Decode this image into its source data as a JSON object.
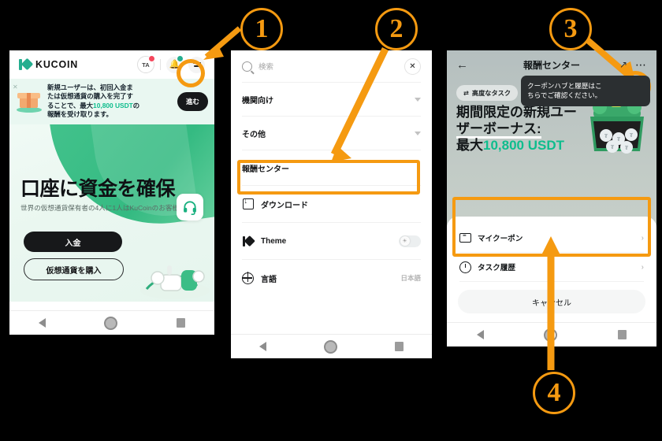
{
  "accent": "#f59a11",
  "brand_green": "#24ae8f",
  "steps": [
    {
      "num": "1"
    },
    {
      "num": "2"
    },
    {
      "num": "3"
    },
    {
      "num": "4"
    }
  ],
  "phone1": {
    "header": {
      "logo_text": "KUCOIN",
      "avatar_initials": "TA",
      "bell_icon": "bell-icon",
      "menu_icon": "hamburger-menu-icon"
    },
    "promo": {
      "line1": "新規ユーザーは、初回入金ま",
      "line2": "たは仮想通貨の購入を完了す",
      "line3_pre": "ることで、最大",
      "line3_hl": "10,800 USDT",
      "line3_post": "の",
      "line4": "報酬を受け取ります。",
      "button": "進む",
      "close_icon": "close-x-icon",
      "gift_icon": "gift-box-icon"
    },
    "hero": {
      "title": "口座に資金を確保",
      "subtitle": "世界の仮想通貨保有者の4人に1人はKuCoinのお客様です",
      "primary_button": "入金",
      "secondary_button": "仮想通貨を購入",
      "support_icon": "headset-icon"
    },
    "navbar": {
      "back": "back-triangle-icon",
      "home": "home-circle-icon",
      "recents": "recents-square-icon"
    }
  },
  "phone2": {
    "search": {
      "placeholder": "検索",
      "icon": "search-icon",
      "close": "close-x-icon"
    },
    "menu": [
      {
        "label": "機関向け",
        "type": "expander",
        "icon": ""
      },
      {
        "label": "その他",
        "type": "expander",
        "icon": ""
      },
      {
        "label": "報酬センター",
        "type": "plain",
        "icon": "",
        "highlighted": true
      },
      {
        "label": "ダウンロード",
        "type": "icon",
        "icon": "download-icon"
      },
      {
        "label": "Theme",
        "type": "toggle",
        "icon": "kucoin-mark-icon",
        "toggle_icon": "sun-icon"
      },
      {
        "label": "言語",
        "type": "value",
        "icon": "globe-icon",
        "value": "日本語"
      }
    ],
    "navbar": {
      "back": "back-triangle-icon",
      "home": "home-circle-icon",
      "recents": "recents-square-icon"
    }
  },
  "phone3": {
    "header": {
      "back_icon": "back-arrow-icon",
      "title": "報酬センター",
      "share_icon": "share-icon",
      "more_icon": "more-dots-icon"
    },
    "tooltip": {
      "line1": "クーポンハブと履歴はこ",
      "line2": "ちらでご確認ください。"
    },
    "chip": {
      "label": "高度なタスク",
      "icon": "swap-arrows-icon"
    },
    "banner": {
      "line1": "期間限定の新規ユー",
      "line2": "ザーボーナス:",
      "line3_pre": "最大",
      "line3_hl": "10,800 USDT",
      "mascot_icon": "frog-treasure-icon"
    },
    "sheet": {
      "items": [
        {
          "label": "マイクーポン",
          "icon": "coupon-icon",
          "chevron": "›"
        },
        {
          "label": "タスク履歴",
          "icon": "clock-history-icon",
          "chevron": "›"
        }
      ],
      "cancel": "キャンセル"
    },
    "navbar": {
      "back": "back-triangle-icon",
      "home": "home-circle-icon",
      "recents": "recents-square-icon"
    }
  }
}
